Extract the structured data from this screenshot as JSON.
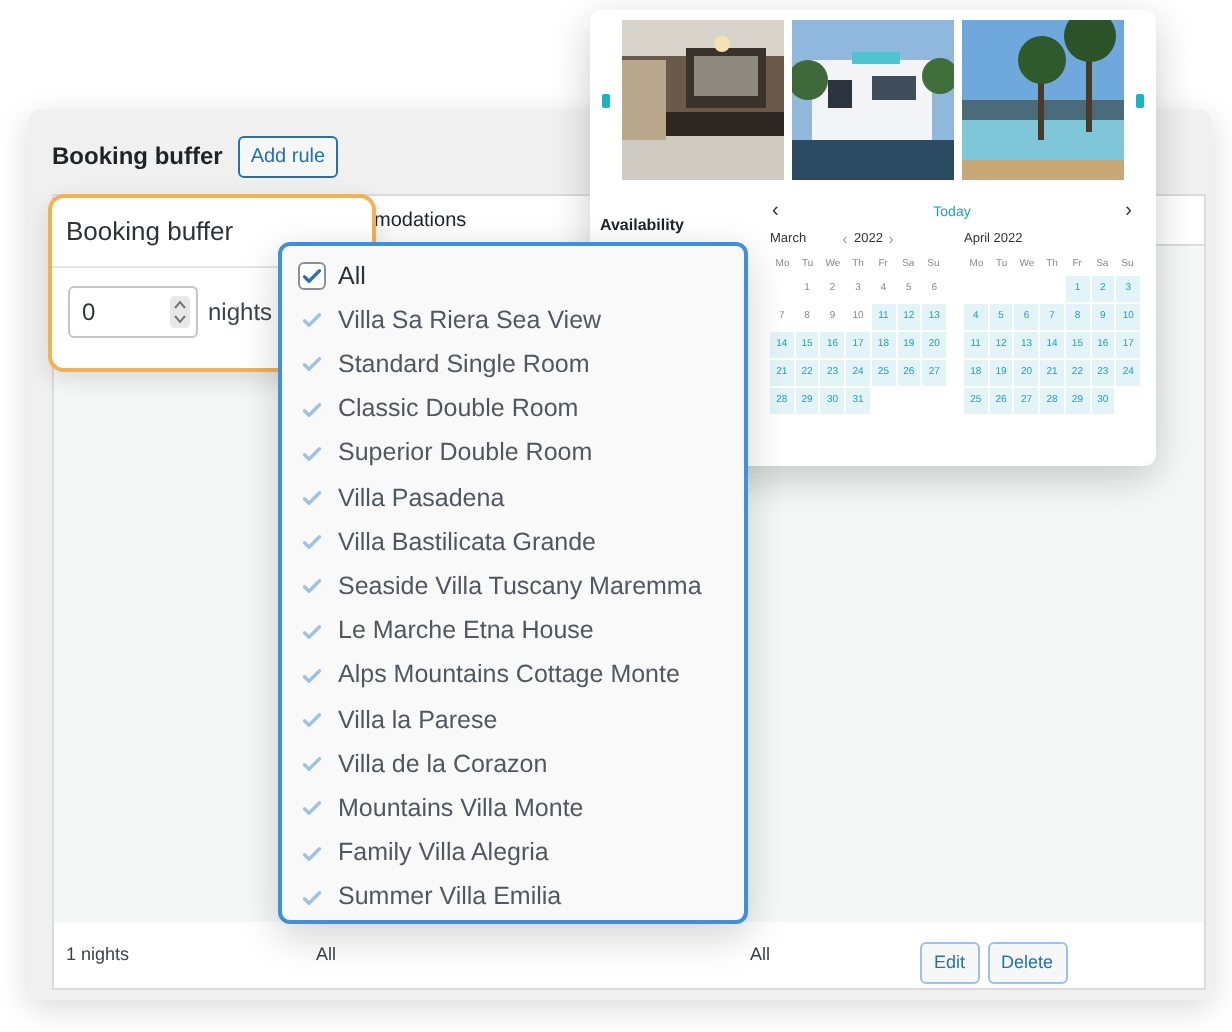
{
  "page": {
    "title": "Booking buffer",
    "add_button": "Add rule"
  },
  "table": {
    "header": [
      "modations"
    ],
    "rows": [
      {
        "cells": [
          "1 nights",
          "All",
          "All"
        ],
        "actions": [
          "Edit",
          "Delete"
        ]
      }
    ]
  },
  "buffer_popup": {
    "title": "Booking buffer",
    "value": "0",
    "unit": "nights"
  },
  "accommodations_dropdown": {
    "items": [
      {
        "label": "All",
        "checked": true,
        "disabled": false
      },
      {
        "label": "Villa Sa Riera Sea View",
        "checked": true,
        "disabled": true
      },
      {
        "label": "Standard Single Room",
        "checked": true,
        "disabled": true
      },
      {
        "label": "Classic Double Room",
        "checked": true,
        "disabled": true
      },
      {
        "label": "Superior Double Room",
        "checked": true,
        "disabled": true
      },
      {
        "label": "Villa Pasadena",
        "checked": true,
        "disabled": true
      },
      {
        "label": "Villa Bastilicata Grande",
        "checked": true,
        "disabled": true
      },
      {
        "label": "Seaside Villa Tuscany Maremma",
        "checked": true,
        "disabled": true
      },
      {
        "label": "Le Marche Etna House",
        "checked": true,
        "disabled": true
      },
      {
        "label": "Alps Mountains Cottage Monte",
        "checked": true,
        "disabled": true
      },
      {
        "label": "Villa la Parese",
        "checked": true,
        "disabled": true
      },
      {
        "label": "Villa de la Corazon",
        "checked": true,
        "disabled": true
      },
      {
        "label": "Mountains Villa Monte",
        "checked": true,
        "disabled": true
      },
      {
        "label": "Family Villa Alegria",
        "checked": true,
        "disabled": true
      },
      {
        "label": "Summer Villa Emilia",
        "checked": true,
        "disabled": true
      }
    ]
  },
  "calendar_popup": {
    "label": "Availability",
    "prev": "‹",
    "today": "Today",
    "next": "›",
    "months": [
      {
        "name": "March",
        "year": "2022",
        "weekdays": [
          "Mo",
          "Tu",
          "We",
          "Th",
          "Fr",
          "Sa",
          "Su"
        ],
        "weeks": [
          [
            {
              "d": "1",
              "available": false
            },
            {
              "d": "2",
              "available": false
            },
            {
              "d": "3",
              "available": false
            },
            {
              "d": "4",
              "available": false
            },
            {
              "d": "5",
              "available": false
            },
            {
              "d": "6",
              "available": false
            }
          ],
          [
            {
              "d": "7",
              "available": false
            },
            {
              "d": "8",
              "available": false
            },
            {
              "d": "9",
              "available": false
            },
            {
              "d": "10",
              "available": false
            },
            {
              "d": "11",
              "available": true
            },
            {
              "d": "12",
              "available": true
            },
            {
              "d": "13",
              "available": true
            }
          ],
          [
            {
              "d": "14",
              "available": true
            },
            {
              "d": "15",
              "available": true
            },
            {
              "d": "16",
              "available": true
            },
            {
              "d": "17",
              "available": true
            },
            {
              "d": "18",
              "available": true
            },
            {
              "d": "19",
              "available": true
            },
            {
              "d": "20",
              "available": true
            }
          ],
          [
            {
              "d": "21",
              "available": true
            },
            {
              "d": "22",
              "available": true
            },
            {
              "d": "23",
              "available": true
            },
            {
              "d": "24",
              "available": true
            },
            {
              "d": "25",
              "available": true
            },
            {
              "d": "26",
              "available": true
            },
            {
              "d": "27",
              "available": true
            }
          ],
          [
            {
              "d": "28",
              "available": true
            },
            {
              "d": "29",
              "available": true
            },
            {
              "d": "30",
              "available": true
            },
            {
              "d": "31",
              "available": true
            }
          ]
        ]
      },
      {
        "name": "April 2022",
        "weekdays": [
          "Mo",
          "Tu",
          "We",
          "Th",
          "Fr",
          "Sa",
          "Su"
        ],
        "weeks": [
          [
            {
              "d": "1",
              "available": true
            },
            {
              "d": "2",
              "available": true
            },
            {
              "d": "3",
              "available": true
            }
          ],
          [
            {
              "d": "4",
              "available": true
            },
            {
              "d": "5",
              "available": true
            },
            {
              "d": "6",
              "available": true
            },
            {
              "d": "7",
              "available": true
            },
            {
              "d": "8",
              "available": true
            },
            {
              "d": "9",
              "available": true
            },
            {
              "d": "10",
              "available": true
            }
          ],
          [
            {
              "d": "11",
              "available": true
            },
            {
              "d": "12",
              "available": true
            },
            {
              "d": "13",
              "available": true
            },
            {
              "d": "14",
              "available": true
            },
            {
              "d": "15",
              "available": true
            },
            {
              "d": "16",
              "available": true
            },
            {
              "d": "17",
              "available": true
            }
          ],
          [
            {
              "d": "18",
              "available": true
            },
            {
              "d": "19",
              "available": true
            },
            {
              "d": "20",
              "available": true
            },
            {
              "d": "21",
              "available": true
            },
            {
              "d": "22",
              "available": true
            },
            {
              "d": "23",
              "available": true
            },
            {
              "d": "24",
              "available": true
            }
          ],
          [
            {
              "d": "25",
              "available": true
            },
            {
              "d": "26",
              "available": true
            },
            {
              "d": "27",
              "available": true
            },
            {
              "d": "28",
              "available": true
            },
            {
              "d": "29",
              "available": true
            },
            {
              "d": "30",
              "available": true
            }
          ]
        ]
      }
    ]
  }
}
